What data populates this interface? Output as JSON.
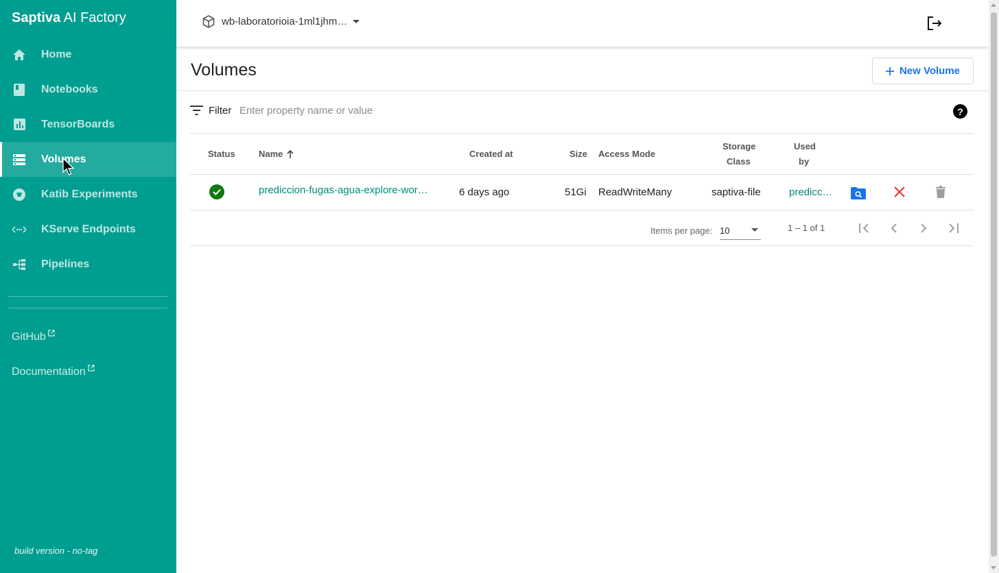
{
  "app": {
    "brand_bold": "Saptiva",
    "brand_rest": " AI Factory"
  },
  "sidebar": {
    "items": [
      {
        "label": "Home",
        "icon": "home-icon",
        "active": false
      },
      {
        "label": "Notebooks",
        "icon": "notebook-icon",
        "active": false
      },
      {
        "label": "TensorBoards",
        "icon": "chart-icon",
        "active": false
      },
      {
        "label": "Volumes",
        "icon": "storage-icon",
        "active": true
      },
      {
        "label": "Katib Experiments",
        "icon": "experiment-icon",
        "active": false
      },
      {
        "label": "KServe Endpoints",
        "icon": "endpoint-icon",
        "active": false
      },
      {
        "label": "Pipelines",
        "icon": "pipeline-icon",
        "active": false
      }
    ],
    "links": [
      {
        "label": "GitHub"
      },
      {
        "label": "Documentation"
      }
    ],
    "build": "build version - no-tag"
  },
  "topbar": {
    "namespace": "wb-laboratorioia-1ml1jhm…"
  },
  "page": {
    "title": "Volumes",
    "new_button": "New Volume"
  },
  "filter": {
    "label": "Filter",
    "placeholder": "Enter property name or value",
    "help": "?"
  },
  "table": {
    "columns": {
      "status": "Status",
      "name": "Name",
      "created": "Created at",
      "size": "Size",
      "access": "Access Mode",
      "storage_line1": "Storage",
      "storage_line2": "Class",
      "used_line1": "Used",
      "used_line2": "by"
    },
    "rows": [
      {
        "status": "ready",
        "name": "prediccion-fugas-agua-explore-wor…",
        "created": "6 days ago",
        "size": "51Gi",
        "access": "ReadWriteMany",
        "storage": "saptiva-file",
        "used_by": "predicc…"
      }
    ]
  },
  "pager": {
    "label": "Items per page:",
    "per_page": "10",
    "range": "1 – 1 of 1"
  },
  "colors": {
    "sidebar": "#009e90",
    "link": "#008b7a",
    "primary": "#1a73e8",
    "danger": "#e53935",
    "status_ok": "#0f7a0f"
  }
}
